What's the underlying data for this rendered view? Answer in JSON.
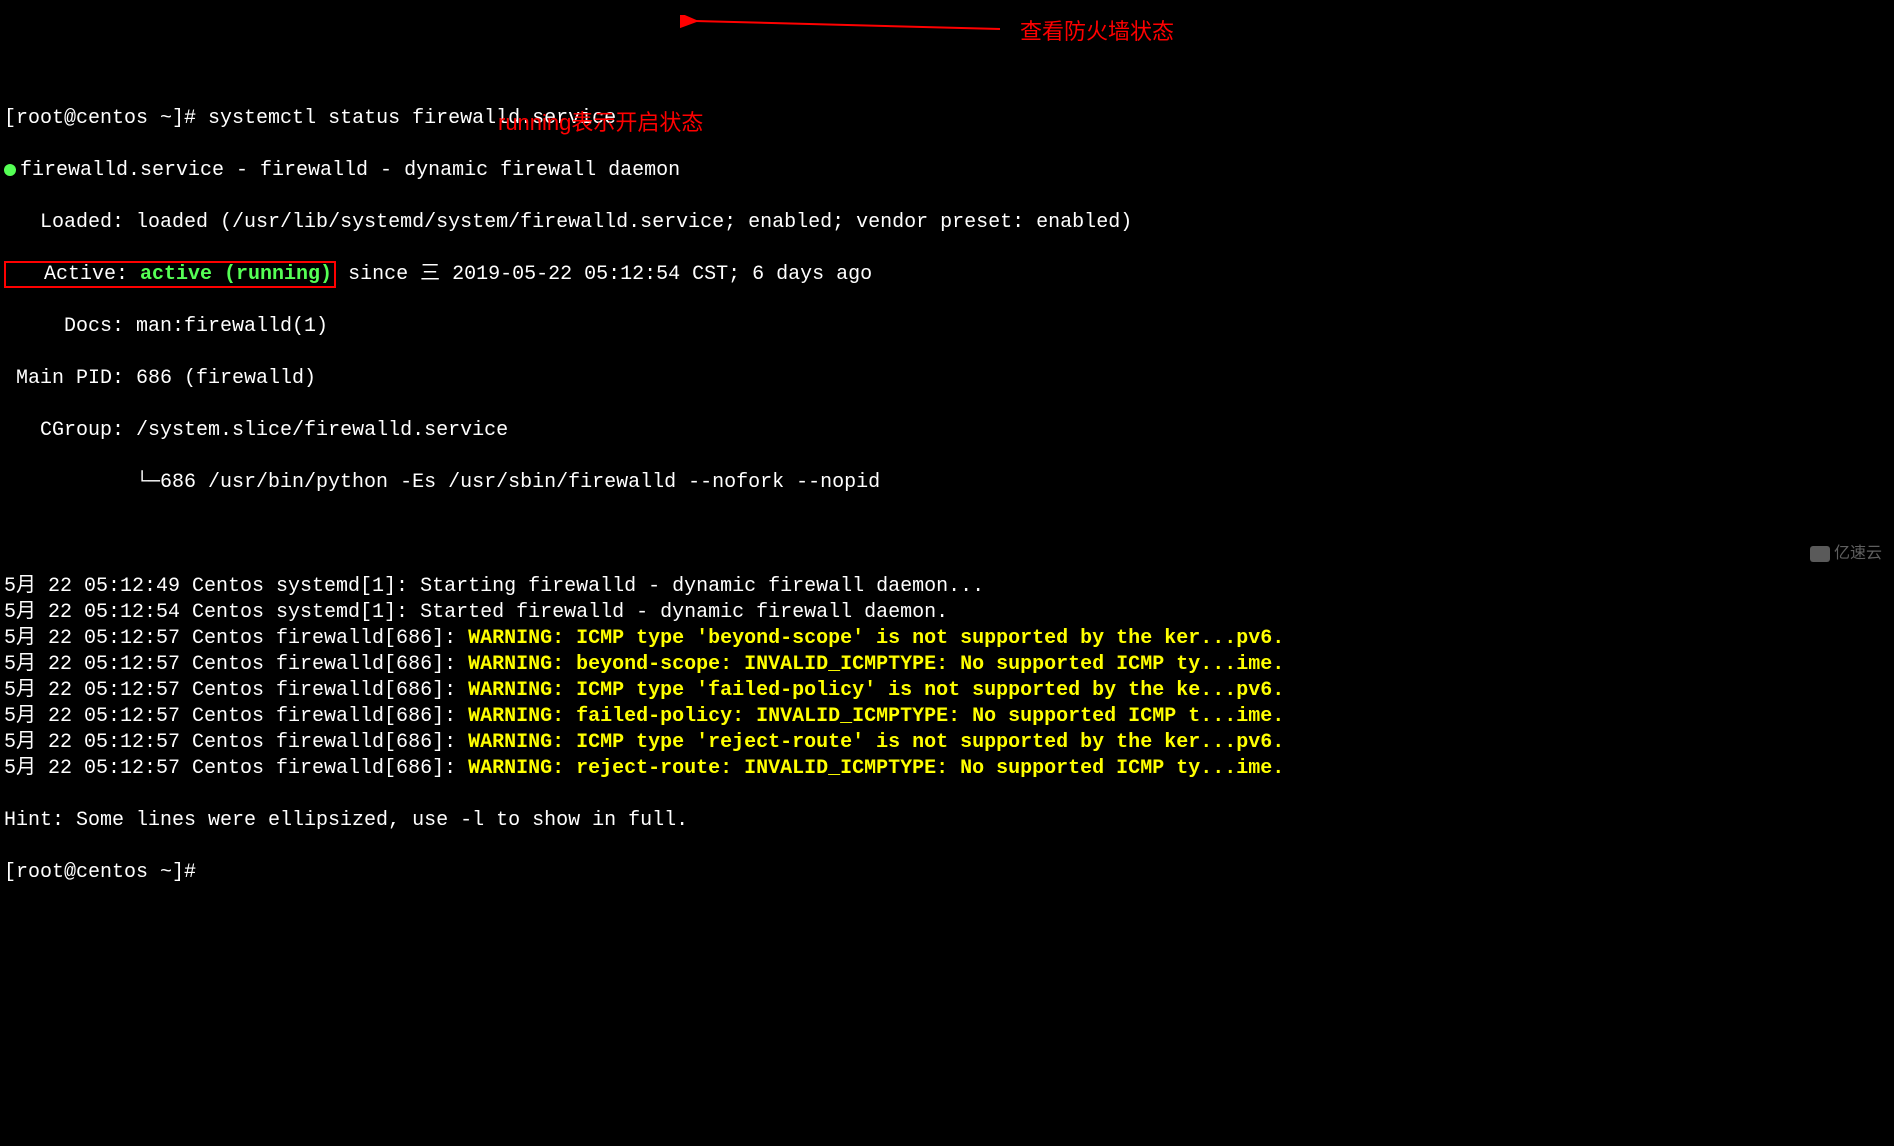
{
  "prompt1": "[root@centos ~]# ",
  "command": "systemctl status firewalld.service",
  "service_line": "firewalld.service - firewalld - dynamic firewall daemon",
  "loaded_label": "   Loaded: ",
  "loaded_value": "loaded (/usr/lib/systemd/system/firewalld.service; enabled; vendor preset: enabled)",
  "active_label": "   Active: ",
  "active_value": "active (running)",
  "active_since": " since 三 2019-05-22 05:12:54 CST; 6 days ago",
  "docs_label": "     Docs: ",
  "docs_value": "man:firewalld(1)",
  "main_pid_label": " Main PID: ",
  "main_pid_value": "686 (firewalld)",
  "cgroup_label": "   CGroup: ",
  "cgroup_value": "/system.slice/firewalld.service",
  "cgroup_tree": "           └─686 /usr/bin/python -Es /usr/sbin/firewalld --nofork --nopid",
  "logs": [
    {
      "time": "5月 22 05:12:49 Centos systemd[1]: ",
      "msg": "Starting firewalld - dynamic firewall daemon...",
      "bold": false
    },
    {
      "time": "5月 22 05:12:54 Centos systemd[1]: ",
      "msg": "Started firewalld - dynamic firewall daemon.",
      "bold": false
    },
    {
      "time": "5月 22 05:12:57 Centos firewalld[686]: ",
      "msg": "WARNING: ICMP type 'beyond-scope' is not supported by the ker...pv6.",
      "bold": true
    },
    {
      "time": "5月 22 05:12:57 Centos firewalld[686]: ",
      "msg": "WARNING: beyond-scope: INVALID_ICMPTYPE: No supported ICMP ty...ime.",
      "bold": true
    },
    {
      "time": "5月 22 05:12:57 Centos firewalld[686]: ",
      "msg": "WARNING: ICMP type 'failed-policy' is not supported by the ke...pv6.",
      "bold": true
    },
    {
      "time": "5月 22 05:12:57 Centos firewalld[686]: ",
      "msg": "WARNING: failed-policy: INVALID_ICMPTYPE: No supported ICMP t...ime.",
      "bold": true
    },
    {
      "time": "5月 22 05:12:57 Centos firewalld[686]: ",
      "msg": "WARNING: ICMP type 'reject-route' is not supported by the ker...pv6.",
      "bold": true
    },
    {
      "time": "5月 22 05:12:57 Centos firewalld[686]: ",
      "msg": "WARNING: reject-route: INVALID_ICMPTYPE: No supported ICMP ty...ime.",
      "bold": true
    }
  ],
  "hint": "Hint: Some lines were ellipsized, use -l to show in full.",
  "prompt2": "[root@centos ~]# ",
  "annotations": {
    "check_status": "查看防火墙状态",
    "running_meaning": "running表示开启状态"
  },
  "watermark": "亿速云"
}
